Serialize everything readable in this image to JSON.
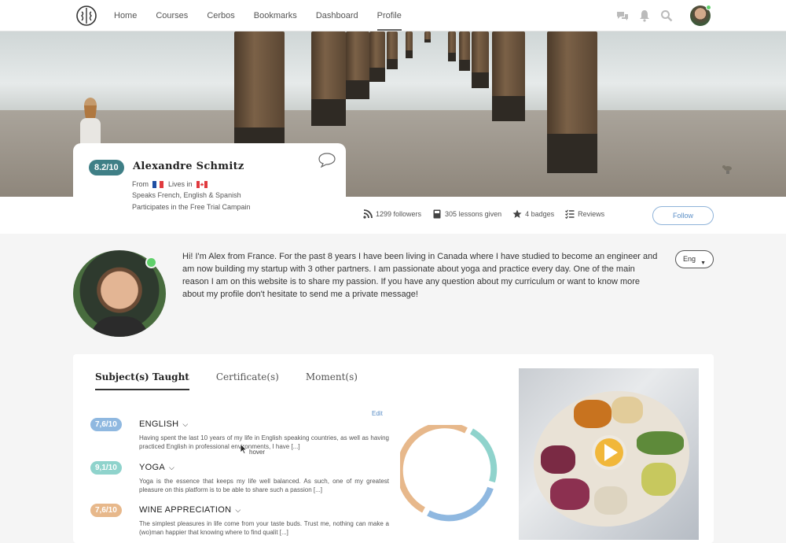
{
  "nav": {
    "links": [
      {
        "label": "Home",
        "active": false
      },
      {
        "label": "Courses",
        "active": false
      },
      {
        "label": "Cerbos",
        "active": false
      },
      {
        "label": "Bookmarks",
        "active": false
      },
      {
        "label": "Dashboard",
        "active": false
      },
      {
        "label": "Profile",
        "active": true
      }
    ],
    "icons": [
      "chat-icon",
      "bell-icon",
      "search-icon"
    ]
  },
  "profile": {
    "score": "8.2/10",
    "name": "Alexandre Schmitz",
    "from_label": "From",
    "from_flag": "France",
    "lives_label": "Lives in",
    "lives_flag": "Canada",
    "languages": "Speaks French, English & Spanish",
    "campaign": "Participates in the Free Trial Campain"
  },
  "stats": {
    "followers": "1299 followers",
    "lessons": "305 lessons given",
    "badges": "4 badges",
    "reviews": "Reviews"
  },
  "follow_label": "Follow",
  "bio": "Hi! I'm Alex from France. For the past 8 years I have been living in Canada where I have studied to become an engineer and am now building my startup with 3 other partners. I am passionate about yoga and practice every day. One of the main reason I am on this website is to share my passion. If you have any question about my curriculum or want to know more about my profile don't hesitate to send me a private message!",
  "language_select": "Eng",
  "tabs": [
    {
      "label": "Subject(s) Taught",
      "active": true
    },
    {
      "label": "Certificate(s)",
      "active": false
    },
    {
      "label": "Moment(s)",
      "active": false
    }
  ],
  "edit_label": "Edit",
  "subjects": [
    {
      "score": "7,6/10",
      "title": "ENGLISH",
      "color": "#8fb8e0",
      "desc": "Having spent the last 10 years of my life in English speaking countries, as well as having practiced English in professional environments, I have [...]"
    },
    {
      "score": "9,1/10",
      "title": "YOGA",
      "color": "#8fd3cc",
      "desc": "Yoga is the essence that keeps my life well balanced. As such, one of my greatest pleasure on this platform is to be able to share such a passion [...]"
    },
    {
      "score": "7,6/10",
      "title": "WINE APPRECIATION",
      "color": "#e7b88b",
      "desc": "The simplest pleasures in life come from your taste buds. Trust me, nothing can make a (wo)man happier that knowing where to find qualit [...]"
    }
  ],
  "hover_note": "hover",
  "colors": {
    "accent": "#3f7f86",
    "link": "#5a8ec6",
    "online": "#5fd06a"
  }
}
